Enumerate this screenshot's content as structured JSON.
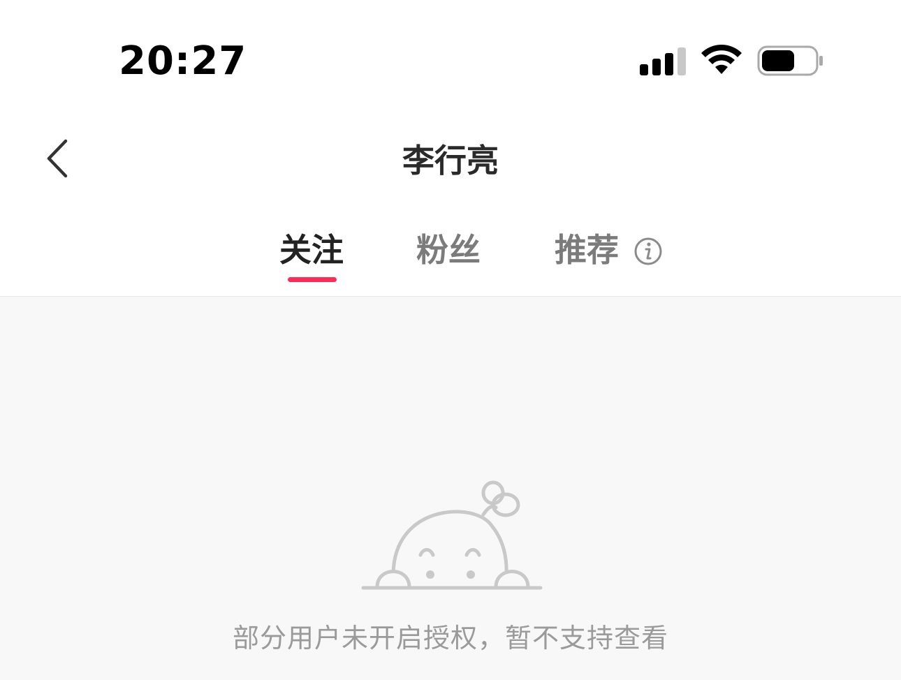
{
  "status_bar": {
    "time": "20:27",
    "signal_icon": "cellular-signal-icon",
    "signal_bars_active": 3,
    "signal_bars_total": 4,
    "wifi_icon": "wifi-icon",
    "battery_icon": "battery-icon",
    "battery_level": 0.55
  },
  "nav": {
    "back_icon": "chevron-left-icon",
    "title": "李行亮"
  },
  "tabs": [
    {
      "label": "关注",
      "active": true
    },
    {
      "label": "粉丝",
      "active": false
    },
    {
      "label": "推荐",
      "active": false,
      "info_icon": "info-icon"
    }
  ],
  "colors": {
    "accent": "#fe2c55",
    "active_tab_text": "#222222",
    "inactive_tab_text": "#7b7b7b",
    "content_background": "#f8f8f8",
    "empty_text": "#9a9a9a"
  },
  "empty_state": {
    "illustration": "peeking-character-illustration",
    "message": "部分用户未开启授权，暂不支持查看"
  }
}
